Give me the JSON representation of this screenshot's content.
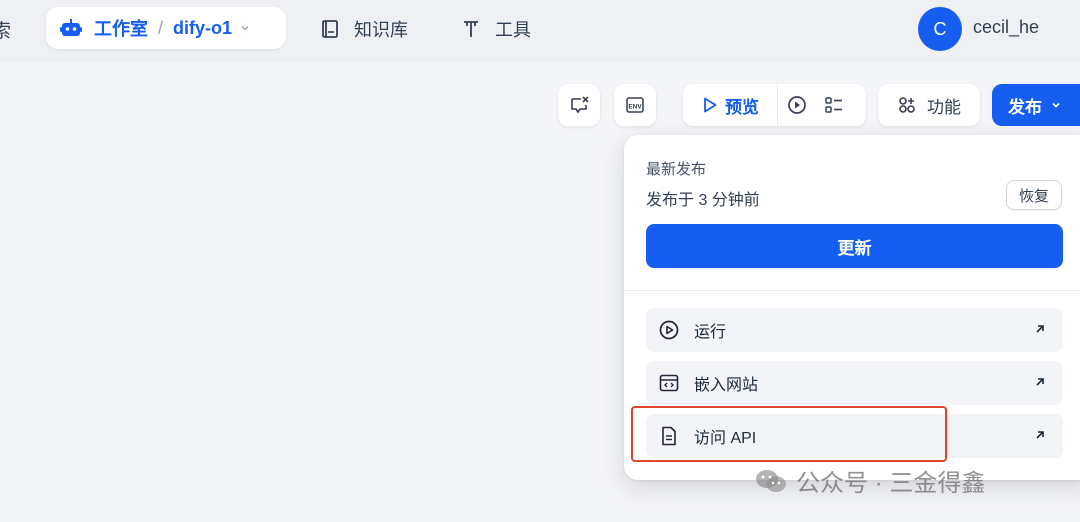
{
  "header": {
    "search_fragment": "索",
    "studio_label": "工作室",
    "separator": "/",
    "app_name": "dify-o1",
    "knowledge_label": "知识库",
    "tools_label": "工具",
    "avatar_letter": "C",
    "username": "cecil_he"
  },
  "toolbar": {
    "preview_label": "预览",
    "features_label": "功能",
    "publish_label": "发布"
  },
  "publish_panel": {
    "latest_label": "最新发布",
    "published_time": "发布于 3 分钟前",
    "restore_label": "恢复",
    "update_label": "更新",
    "items": [
      {
        "label": "运行",
        "icon": "play-circle-icon"
      },
      {
        "label": "嵌入网站",
        "icon": "embed-code-icon"
      },
      {
        "label": "访问 API",
        "icon": "document-icon"
      }
    ]
  },
  "watermark": {
    "text": "公众号 · 三金得鑫"
  },
  "colors": {
    "accent": "#155eef",
    "highlight": "#e0462f"
  }
}
